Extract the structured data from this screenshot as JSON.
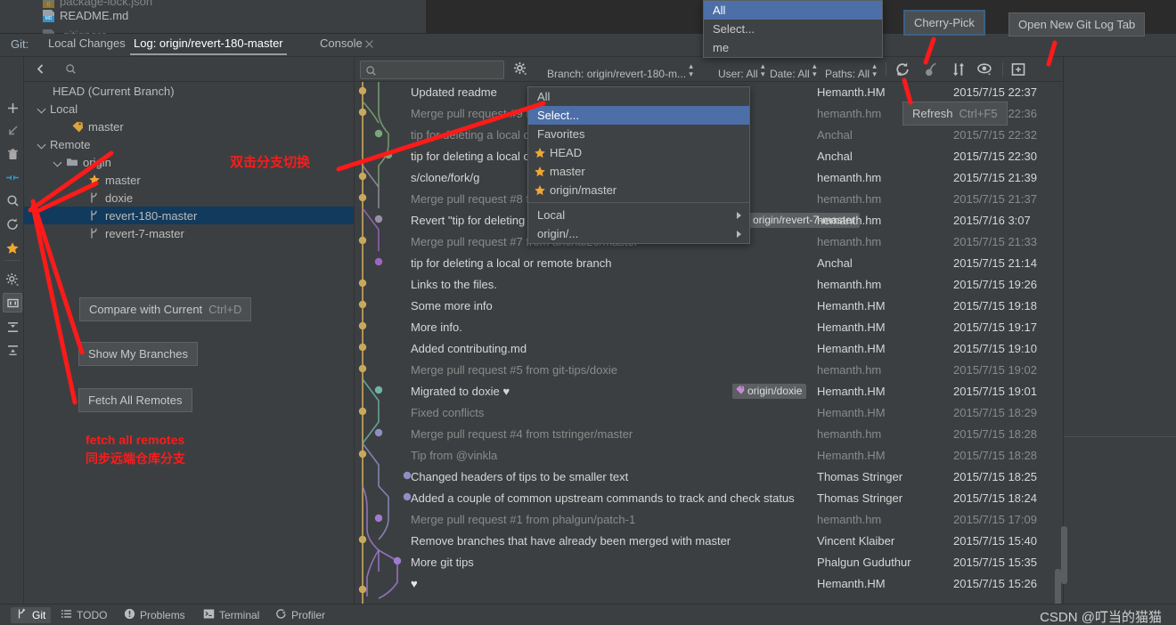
{
  "project_files": [
    {
      "name": "package-lock.json",
      "icon": "json-file-icon"
    },
    {
      "name": "README.md",
      "icon": "markdown-file-icon"
    },
    {
      "name": ".gitignore",
      "icon": "file-icon"
    }
  ],
  "tabbar": {
    "prefix_label": "Git:",
    "tabs": [
      {
        "label": "Local Changes",
        "active": false,
        "closable": false
      },
      {
        "label": "Log: origin/revert-180-master",
        "active": true,
        "closable": false
      },
      {
        "label": "Console",
        "active": false,
        "closable": true
      }
    ]
  },
  "left_toolbar": {
    "buttons": [
      {
        "name": "add-icon",
        "glyph": "+"
      },
      {
        "name": "checkout-arrow-icon",
        "glyph": "arrow-down-left"
      },
      {
        "name": "delete-trash-icon",
        "glyph": "trash"
      },
      {
        "name": "compare-branches-icon",
        "glyph": "compare"
      },
      {
        "name": "search-icon",
        "glyph": "magnifier"
      },
      {
        "name": "fetch-all-remotes-icon",
        "glyph": "refresh"
      },
      {
        "name": "show-my-branches-icon",
        "glyph": "star"
      },
      {
        "name": "settings-gear-icon",
        "glyph": "gear"
      },
      {
        "name": "show-folders-icon",
        "glyph": "folder",
        "selected": true
      },
      {
        "name": "expand-all-icon",
        "glyph": "expand"
      },
      {
        "name": "collapse-all-icon",
        "glyph": "collapse"
      }
    ]
  },
  "branch_tree": {
    "search_placeholder": "",
    "rows": [
      {
        "label": "HEAD (Current Branch)",
        "indent": 0,
        "icon": "none",
        "twisty": false,
        "selected": false
      },
      {
        "label": "Local",
        "indent": 0,
        "icon": "none",
        "twisty": true,
        "selected": false
      },
      {
        "label": "master",
        "indent": 1,
        "icon": "tag-icon",
        "twisty": false,
        "selected": false
      },
      {
        "label": "Remote",
        "indent": 0,
        "icon": "none",
        "twisty": true,
        "selected": false
      },
      {
        "label": "origin",
        "indent": 1,
        "icon": "folder-icon",
        "twisty": true,
        "selected": false
      },
      {
        "label": "master",
        "indent": 2,
        "icon": "star-icon",
        "twisty": false,
        "selected": false
      },
      {
        "label": "doxie",
        "indent": 2,
        "icon": "branch-icon",
        "twisty": false,
        "selected": false
      },
      {
        "label": "revert-180-master",
        "indent": 2,
        "icon": "branch-icon",
        "twisty": false,
        "selected": true
      },
      {
        "label": "revert-7-master",
        "indent": 2,
        "icon": "branch-icon",
        "twisty": false,
        "selected": false
      }
    ]
  },
  "log_toolbar": {
    "search_placeholder": "",
    "gear_icon": "gear-icon",
    "filters": [
      {
        "name": "branch-filter",
        "label": "Branch: origin/revert-180-m..."
      },
      {
        "name": "user-filter",
        "label": "User: All"
      },
      {
        "name": "date-filter",
        "label": "Date: All"
      },
      {
        "name": "paths-filter",
        "label": "Paths: All"
      }
    ],
    "icons": [
      {
        "name": "refresh-icon"
      },
      {
        "name": "cherry-pick-icon"
      },
      {
        "name": "show-long-edges-icon"
      },
      {
        "name": "intellisort-eye-icon"
      },
      {
        "name": "open-new-git-log-tab-icon"
      },
      {
        "name": "log-search-icon"
      },
      {
        "name": "go-to-hash-icon"
      },
      {
        "name": "revert-icon"
      },
      {
        "name": "group-by-icon"
      },
      {
        "name": "filter-icon"
      }
    ]
  },
  "commits": {
    "rows": [
      {
        "subject": "Updated readme",
        "author": "Hemanth.HM",
        "date": "2015/7/15 22:37",
        "dim": false
      },
      {
        "subject": "Merge pull request #9 from anchal20/master",
        "author": "hemanth.hm",
        "date": "2015/7/15 22:36",
        "dim": true
      },
      {
        "subject": "tip for deleting a local or remote branch",
        "author": "Anchal",
        "date": "2015/7/15 22:32",
        "dim": true
      },
      {
        "subject": "tip for deleting a local or remote branch",
        "author": "Anchal",
        "date": "2015/7/15 22:30",
        "dim": false
      },
      {
        "subject": "s/clone/fork/g",
        "author": "hemanth.hm",
        "date": "2015/7/15 21:39",
        "dim": false
      },
      {
        "subject": "Merge pull request #8 from git-tips/revert-7-master",
        "author": "hemanth.hm",
        "date": "2015/7/15 21:37",
        "dim": true
      },
      {
        "subject": "Revert \"tip for deleting a local or remote branch\"",
        "author": "hemanth.hm",
        "date": "2015/7/16 3:07",
        "dim": false,
        "ref": "origin/revert-7-master"
      },
      {
        "subject": "Merge pull request #7 from anchal20/master",
        "author": "hemanth.hm",
        "date": "2015/7/15 21:33",
        "dim": true
      },
      {
        "subject": "tip for deleting a local or remote branch",
        "author": "Anchal",
        "date": "2015/7/15 21:14",
        "dim": false
      },
      {
        "subject": "Links to the files.",
        "author": "hemanth.hm",
        "date": "2015/7/15 19:26",
        "dim": false
      },
      {
        "subject": "Some more info",
        "author": "Hemanth.HM",
        "date": "2015/7/15 19:18",
        "dim": false
      },
      {
        "subject": "More info.",
        "author": "Hemanth.HM",
        "date": "2015/7/15 19:17",
        "dim": false
      },
      {
        "subject": "Added contributing.md",
        "author": "Hemanth.HM",
        "date": "2015/7/15 19:10",
        "dim": false
      },
      {
        "subject": "Merge pull request #5 from git-tips/doxie",
        "author": "hemanth.hm",
        "date": "2015/7/15 19:02",
        "dim": true
      },
      {
        "subject": "Migrated to doxie ♥",
        "author": "Hemanth.HM",
        "date": "2015/7/15 19:01",
        "dim": false,
        "ref": "origin/doxie"
      },
      {
        "subject": "Fixed conflicts",
        "author": "Hemanth.HM",
        "date": "2015/7/15 18:29",
        "dim": true
      },
      {
        "subject": "Merge pull request #4 from tstringer/master",
        "author": "hemanth.hm",
        "date": "2015/7/15 18:28",
        "dim": true
      },
      {
        "subject": "Tip from @vinkla",
        "author": "Hemanth.HM",
        "date": "2015/7/15 18:28",
        "dim": true
      },
      {
        "subject": "Changed headers of tips to be smaller text",
        "author": "Thomas Stringer",
        "date": "2015/7/15 18:25",
        "dim": false
      },
      {
        "subject": "Added a couple of common upstream commands to track and check status",
        "author": "Thomas Stringer",
        "date": "2015/7/15 18:24",
        "dim": false
      },
      {
        "subject": "Merge pull request #1 from phalgun/patch-1",
        "author": "hemanth.hm",
        "date": "2015/7/15 17:09",
        "dim": true
      },
      {
        "subject": "Remove branches that have already been merged with master",
        "author": "Vincent Klaiber",
        "date": "2015/7/15 15:40",
        "dim": false
      },
      {
        "subject": "More git tips",
        "author": "Phalgun Guduthur",
        "date": "2015/7/15 15:35",
        "dim": false
      },
      {
        "subject": "♥",
        "author": "Hemanth.HM",
        "date": "2015/7/15 15:26",
        "dim": false
      }
    ]
  },
  "user_filter_popup": {
    "items": [
      {
        "label": "All",
        "highlighted": true
      },
      {
        "label": "Select...",
        "highlighted": false
      },
      {
        "label": "me",
        "highlighted": false
      }
    ]
  },
  "branch_filter_popup": {
    "items": [
      {
        "label": "All",
        "highlighted": false,
        "starred": false,
        "submenu": false
      },
      {
        "label": "Select...",
        "highlighted": true,
        "starred": false,
        "submenu": false
      },
      {
        "label": "Favorites",
        "highlighted": false,
        "starred": false,
        "submenu": false
      },
      {
        "label": "HEAD",
        "highlighted": false,
        "starred": true,
        "submenu": false
      },
      {
        "label": "master",
        "highlighted": false,
        "starred": true,
        "submenu": false
      },
      {
        "label": "origin/master",
        "highlighted": false,
        "starred": true,
        "submenu": false
      },
      {
        "label": "Local",
        "highlighted": false,
        "starred": false,
        "submenu": true,
        "separator_before": true
      },
      {
        "label": "origin/...",
        "highlighted": false,
        "starred": false,
        "submenu": true
      }
    ]
  },
  "tooltips": {
    "cherry_pick": "Cherry-Pick",
    "open_new_git_log_tab": "Open New Git Log Tab",
    "refresh": {
      "label": "Refresh",
      "shortcut": "Ctrl+F5"
    },
    "compare_with_current": {
      "label": "Compare with Current",
      "shortcut": "Ctrl+D"
    },
    "show_my_branches": "Show My Branches",
    "fetch_all_remotes": "Fetch All Remotes"
  },
  "annotations": {
    "switch_branch_note": "双击分支切换",
    "fetch_note_en": "fetch all remotes",
    "fetch_note_zh": "同步远端仓库分支",
    "color": "#ff1a1a"
  },
  "statusbar": {
    "items": [
      {
        "label": "Git",
        "icon": "git-branch-icon",
        "active": true
      },
      {
        "label": "TODO",
        "icon": "list-icon",
        "active": false
      },
      {
        "label": "Problems",
        "icon": "warning-icon",
        "active": false
      },
      {
        "label": "Terminal",
        "icon": "terminal-icon",
        "active": false
      },
      {
        "label": "Profiler",
        "icon": "profiler-icon",
        "active": false
      }
    ]
  },
  "watermark": "CSDN @叮当的猫猫"
}
